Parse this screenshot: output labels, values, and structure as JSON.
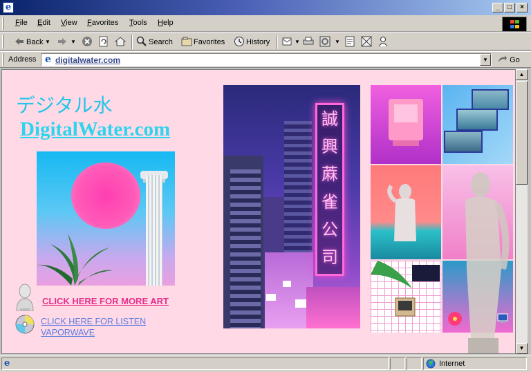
{
  "window": {
    "title_icon": "e",
    "minimize": "_",
    "maximize": "□",
    "close": "×"
  },
  "menu": {
    "items": [
      {
        "label": "File",
        "key": "F",
        "rest": "ile"
      },
      {
        "label": "Edit",
        "key": "E",
        "rest": "dit"
      },
      {
        "label": "View",
        "key": "V",
        "rest": "iew"
      },
      {
        "label": "Favorites",
        "key": "F",
        "rest": "avorites"
      },
      {
        "label": "Tools",
        "key": "T",
        "rest": "ools"
      },
      {
        "label": "Help",
        "key": "H",
        "rest": "elp"
      }
    ]
  },
  "toolbar": {
    "back": "Back",
    "search": "Search",
    "favorites": "Favorites",
    "history": "History"
  },
  "address": {
    "label": "Address",
    "url": "digitalwater.com",
    "go": "Go"
  },
  "page": {
    "jp_title": "デジタル水",
    "site_title": "DigitalWater.com",
    "link_art": "CLICK HERE FOR MORE ART",
    "link_vaporwave_line1": "CLICK HERE FOR LISTEN",
    "link_vaporwave_line2": "VAPORWAVE",
    "neon_chars": [
      "誠",
      "興",
      "蔴",
      "雀",
      "公",
      "司"
    ]
  },
  "status": {
    "zone": "Internet"
  },
  "colors": {
    "background": "#ffd9e6",
    "title_cyan": "#2cd4ec",
    "link_pink": "#e8308a",
    "link_blue": "#5a7ae0"
  }
}
